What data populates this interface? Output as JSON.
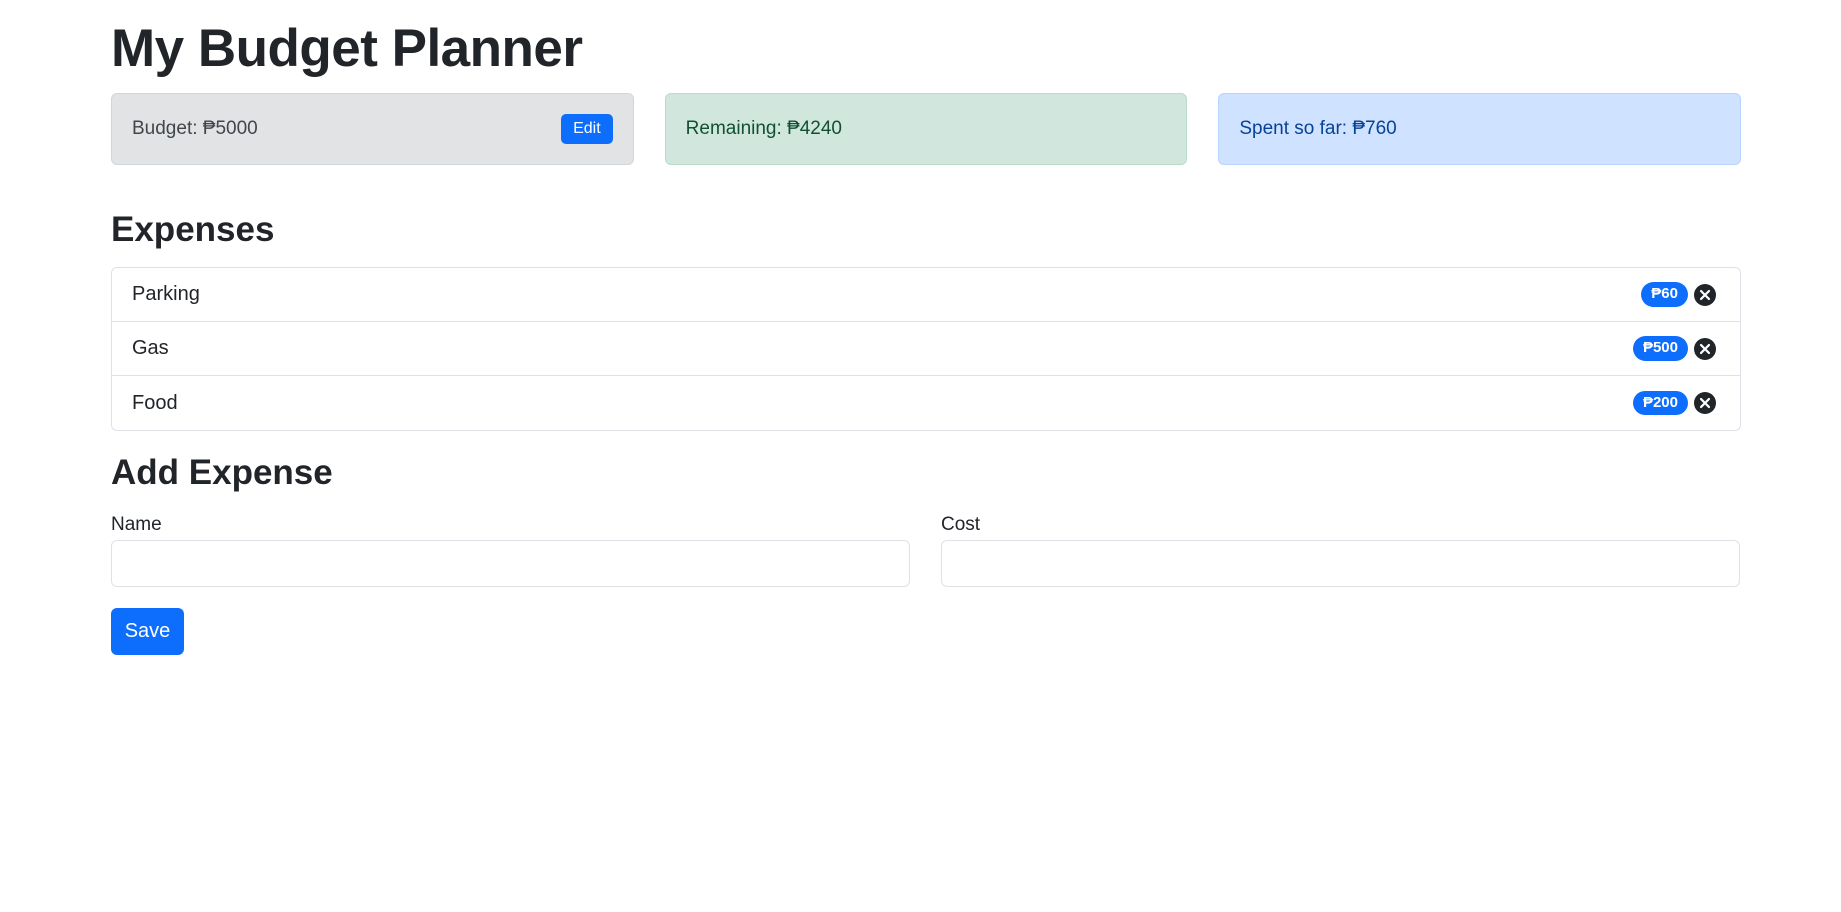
{
  "header": {
    "title": "My Budget Planner"
  },
  "cards": {
    "budget": {
      "label": "Budget: ₱5000",
      "edit_label": "Edit"
    },
    "remaining": {
      "label": "Remaining: ₱4240"
    },
    "spent": {
      "label": "Spent so far: ₱760"
    }
  },
  "expenses": {
    "title": "Expenses",
    "items": [
      {
        "name": "Parking",
        "cost": "₱60"
      },
      {
        "name": "Gas",
        "cost": "₱500"
      },
      {
        "name": "Food",
        "cost": "₱200"
      }
    ]
  },
  "form": {
    "title": "Add Expense",
    "name_label": "Name",
    "name_value": "",
    "cost_label": "Cost",
    "cost_value": "",
    "save_label": "Save"
  },
  "icons": {
    "remove": "close-circle-icon"
  },
  "colors": {
    "primary": "#0d6efd",
    "success_bg": "#d1e7dd",
    "info_bg": "#cfe2ff",
    "secondary_bg": "#e2e3e5"
  }
}
